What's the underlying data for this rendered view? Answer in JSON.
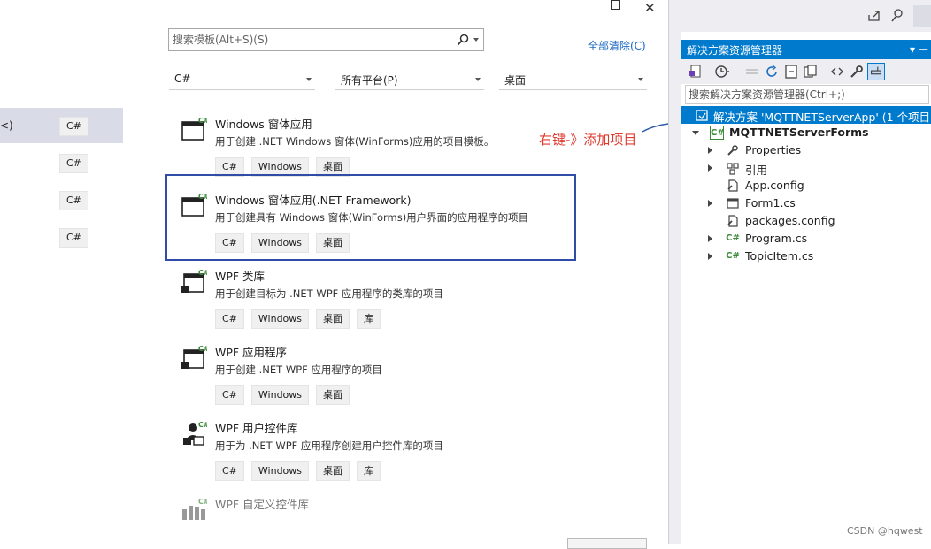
{
  "dialog": {
    "search": {
      "placeholder": "搜索模板(Alt+S)(S)"
    },
    "clear_all": "全部清除(C)",
    "filters": {
      "language": "C#",
      "platform": "所有平台(P)",
      "project_type": "桌面"
    },
    "left_list": [
      {
        "label": "<)",
        "tag": "C#",
        "selected": true
      },
      {
        "label": "",
        "tag": "C#"
      },
      {
        "label": "",
        "tag": "C#"
      },
      {
        "label": "",
        "tag": "C#"
      }
    ],
    "templates": [
      {
        "name": "Windows 窗体应用",
        "desc": "用于创建 .NET Windows 窗体(WinForms)应用的项目模板。",
        "tags": [
          "C#",
          "Windows",
          "桌面"
        ]
      },
      {
        "name": "Windows 窗体应用(.NET Framework)",
        "desc": "用于创建具有 Windows 窗体(WinForms)用户界面的应用程序的项目",
        "tags": [
          "C#",
          "Windows",
          "桌面"
        ]
      },
      {
        "name": "WPF 类库",
        "desc": "用于创建目标为 .NET WPF 应用程序的类库的项目",
        "tags": [
          "C#",
          "Windows",
          "桌面",
          "库"
        ]
      },
      {
        "name": "WPF 应用程序",
        "desc": "用于创建 .NET WPF 应用程序的项目",
        "tags": [
          "C#",
          "Windows",
          "桌面"
        ]
      },
      {
        "name": "WPF 用户控件库",
        "desc": "用于为 .NET WPF 应用程序创建用户控件库的项目",
        "tags": [
          "C#",
          "Windows",
          "桌面",
          "库"
        ]
      },
      {
        "name": "WPF 自定义控件库",
        "desc": "",
        "tags": []
      }
    ],
    "annotation": "右键-》添加项目"
  },
  "solution_explorer": {
    "title": "解决方案资源管理器",
    "pin": "▾ ᅮ",
    "search_placeholder": "搜索解决方案资源管理器(Ctrl+;)",
    "solution_label": "解决方案 'MQTTNETServerApp' (1 个项目,",
    "project": "MQTTNETServerForms",
    "items": [
      "Properties",
      "引用",
      "App.config",
      "Form1.cs",
      "packages.config",
      "Program.cs",
      "TopicItem.cs"
    ]
  },
  "watermark": "CSDN @hqwest",
  "colors": {
    "accent": "#007acc",
    "highlight_box": "#2f4ca7",
    "annotation": "#e03a2f",
    "link": "#1a66c2"
  }
}
